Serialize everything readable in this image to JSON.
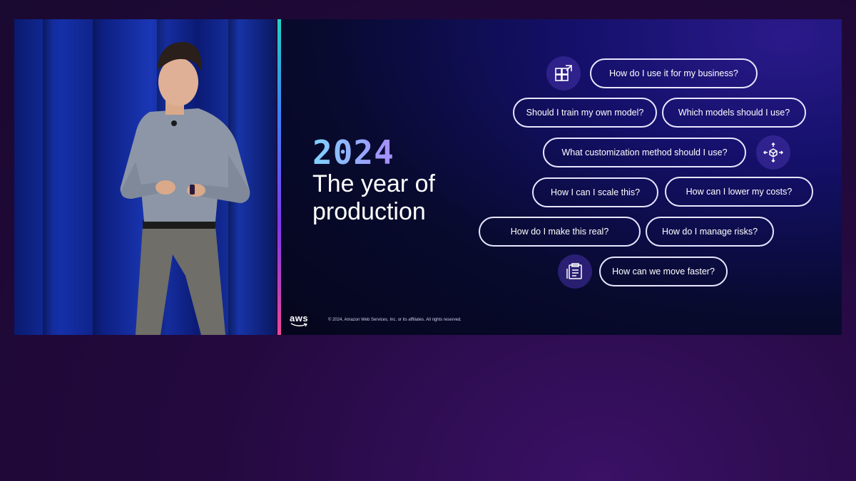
{
  "slide": {
    "year": "2024",
    "headline": "The year of production",
    "questions": [
      "How do I use it for my business?",
      "Should I train my own model?",
      "Which models should I use?",
      "What customization method should I use?",
      "How I can I scale this?",
      "How can I lower my costs?",
      "How do I make this real?",
      "How do I manage risks?",
      "How can we move faster?"
    ],
    "icons": [
      "grid-expand-icon",
      "cube-arrows-icon",
      "checklist-icon"
    ],
    "logo": "aws",
    "copyright": "© 2024, Amazon Web Services, Inc. or its affiliates. All rights reserved."
  },
  "colors": {
    "background": "#24093f",
    "slide_bg": "#080a2e",
    "pill_border": "#e8e6ff",
    "year_gradient_start": "#7fd3ff",
    "year_gradient_end": "#a78bfa",
    "accent_bar_top": "#22d3c5",
    "accent_bar_bottom": "#ec4899"
  }
}
